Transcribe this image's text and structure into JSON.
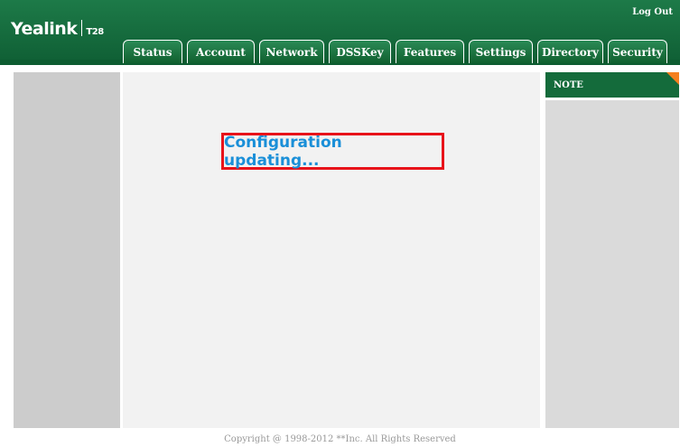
{
  "brand": {
    "name": "Yealink",
    "model": "T28"
  },
  "header": {
    "logout_label": "Log Out"
  },
  "tabs": [
    {
      "label": "Status"
    },
    {
      "label": "Account"
    },
    {
      "label": "Network"
    },
    {
      "label": "DSSKey"
    },
    {
      "label": "Features"
    },
    {
      "label": "Settings"
    },
    {
      "label": "Directory"
    },
    {
      "label": "Security"
    }
  ],
  "main": {
    "status_message": "Configuration updating..."
  },
  "note": {
    "title": "NOTE"
  },
  "footer": {
    "copyright": "Copyright @ 1998-2012 **Inc. All Rights Reserved"
  },
  "colors": {
    "header_green": "#1d7a48",
    "note_green": "#146b3b",
    "status_text": "#1a8fd8",
    "highlight_border": "#e8131a",
    "note_corner": "#f5801f"
  }
}
